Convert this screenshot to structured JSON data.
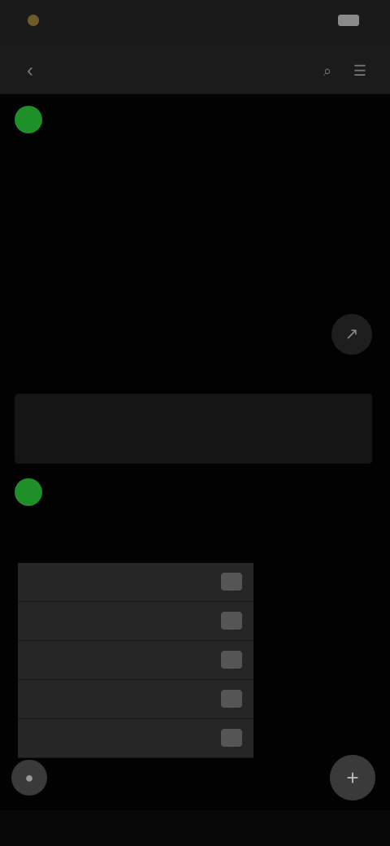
{
  "status_bar": {
    "time": "",
    "signal": "",
    "battery": ""
  },
  "header": {
    "back_icon": "‹",
    "title": "",
    "search_icon": "⌕",
    "menu_icon": "☰"
  },
  "post1": {
    "avatar": "",
    "author": "",
    "author2": "",
    "time": "",
    "title": "",
    "lines": [
      "",
      "",
      "",
      ""
    ],
    "meta": [
      "",
      "",
      "",
      ""
    ],
    "share_icon": "↗"
  },
  "ad": {
    "lines": [
      "",
      "",
      ""
    ]
  },
  "post2": {
    "avatar": "",
    "author": "",
    "author2": "",
    "time": "",
    "title": "",
    "list": [
      {
        "name": "",
        "value": ""
      },
      {
        "name": "",
        "value": ""
      },
      {
        "name": "",
        "value": ""
      },
      {
        "name": "",
        "value": ""
      },
      {
        "name": "",
        "value": ""
      }
    ]
  },
  "bottom": {
    "left_icon": "●",
    "right_icon": "+"
  }
}
